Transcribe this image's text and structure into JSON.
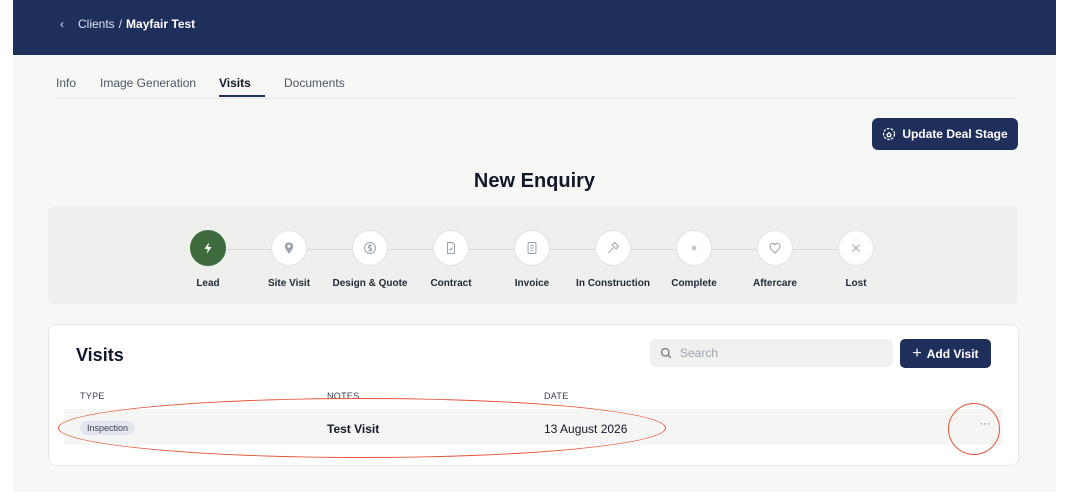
{
  "breadcrumb": {
    "back_icon": "chevron-left-icon",
    "parent": "Clients",
    "separator": "/",
    "current": "Mayfair Test"
  },
  "tabs": [
    {
      "label": "Info",
      "active": false
    },
    {
      "label": "Image Generation",
      "active": false
    },
    {
      "label": "Visits",
      "active": true
    },
    {
      "label": "Documents",
      "active": false
    }
  ],
  "deal_button": {
    "label": "Update Deal Stage",
    "icon": "deal-stage-icon"
  },
  "stage_title": "New Enquiry",
  "pipeline": {
    "active_color": "#3d6b3e",
    "stages": [
      {
        "label": "Lead",
        "icon": "lightning-icon",
        "active": true
      },
      {
        "label": "Site Visit",
        "icon": "location-pin-icon",
        "active": false
      },
      {
        "label": "Design & Quote",
        "icon": "dollar-icon",
        "active": false
      },
      {
        "label": "Contract",
        "icon": "document-check-icon",
        "active": false
      },
      {
        "label": "Invoice",
        "icon": "invoice-icon",
        "active": false
      },
      {
        "label": "In Construction",
        "icon": "hammer-icon",
        "active": false
      },
      {
        "label": "Complete",
        "icon": "dot-icon",
        "active": false
      },
      {
        "label": "Aftercare",
        "icon": "heart-icon",
        "active": false
      },
      {
        "label": "Lost",
        "icon": "close-icon",
        "active": false
      }
    ]
  },
  "visits": {
    "title": "Visits",
    "search_placeholder": "Search",
    "add_label": "Add Visit",
    "columns": {
      "type": "TYPE",
      "notes": "NOTES",
      "date": "DATE"
    },
    "rows": [
      {
        "type": "Inspection",
        "notes": "Test Visit",
        "date": "13 August 2026",
        "actions": "···"
      }
    ]
  },
  "colors": {
    "navy": "#1f2f5c",
    "annotation": "#e4563a"
  }
}
